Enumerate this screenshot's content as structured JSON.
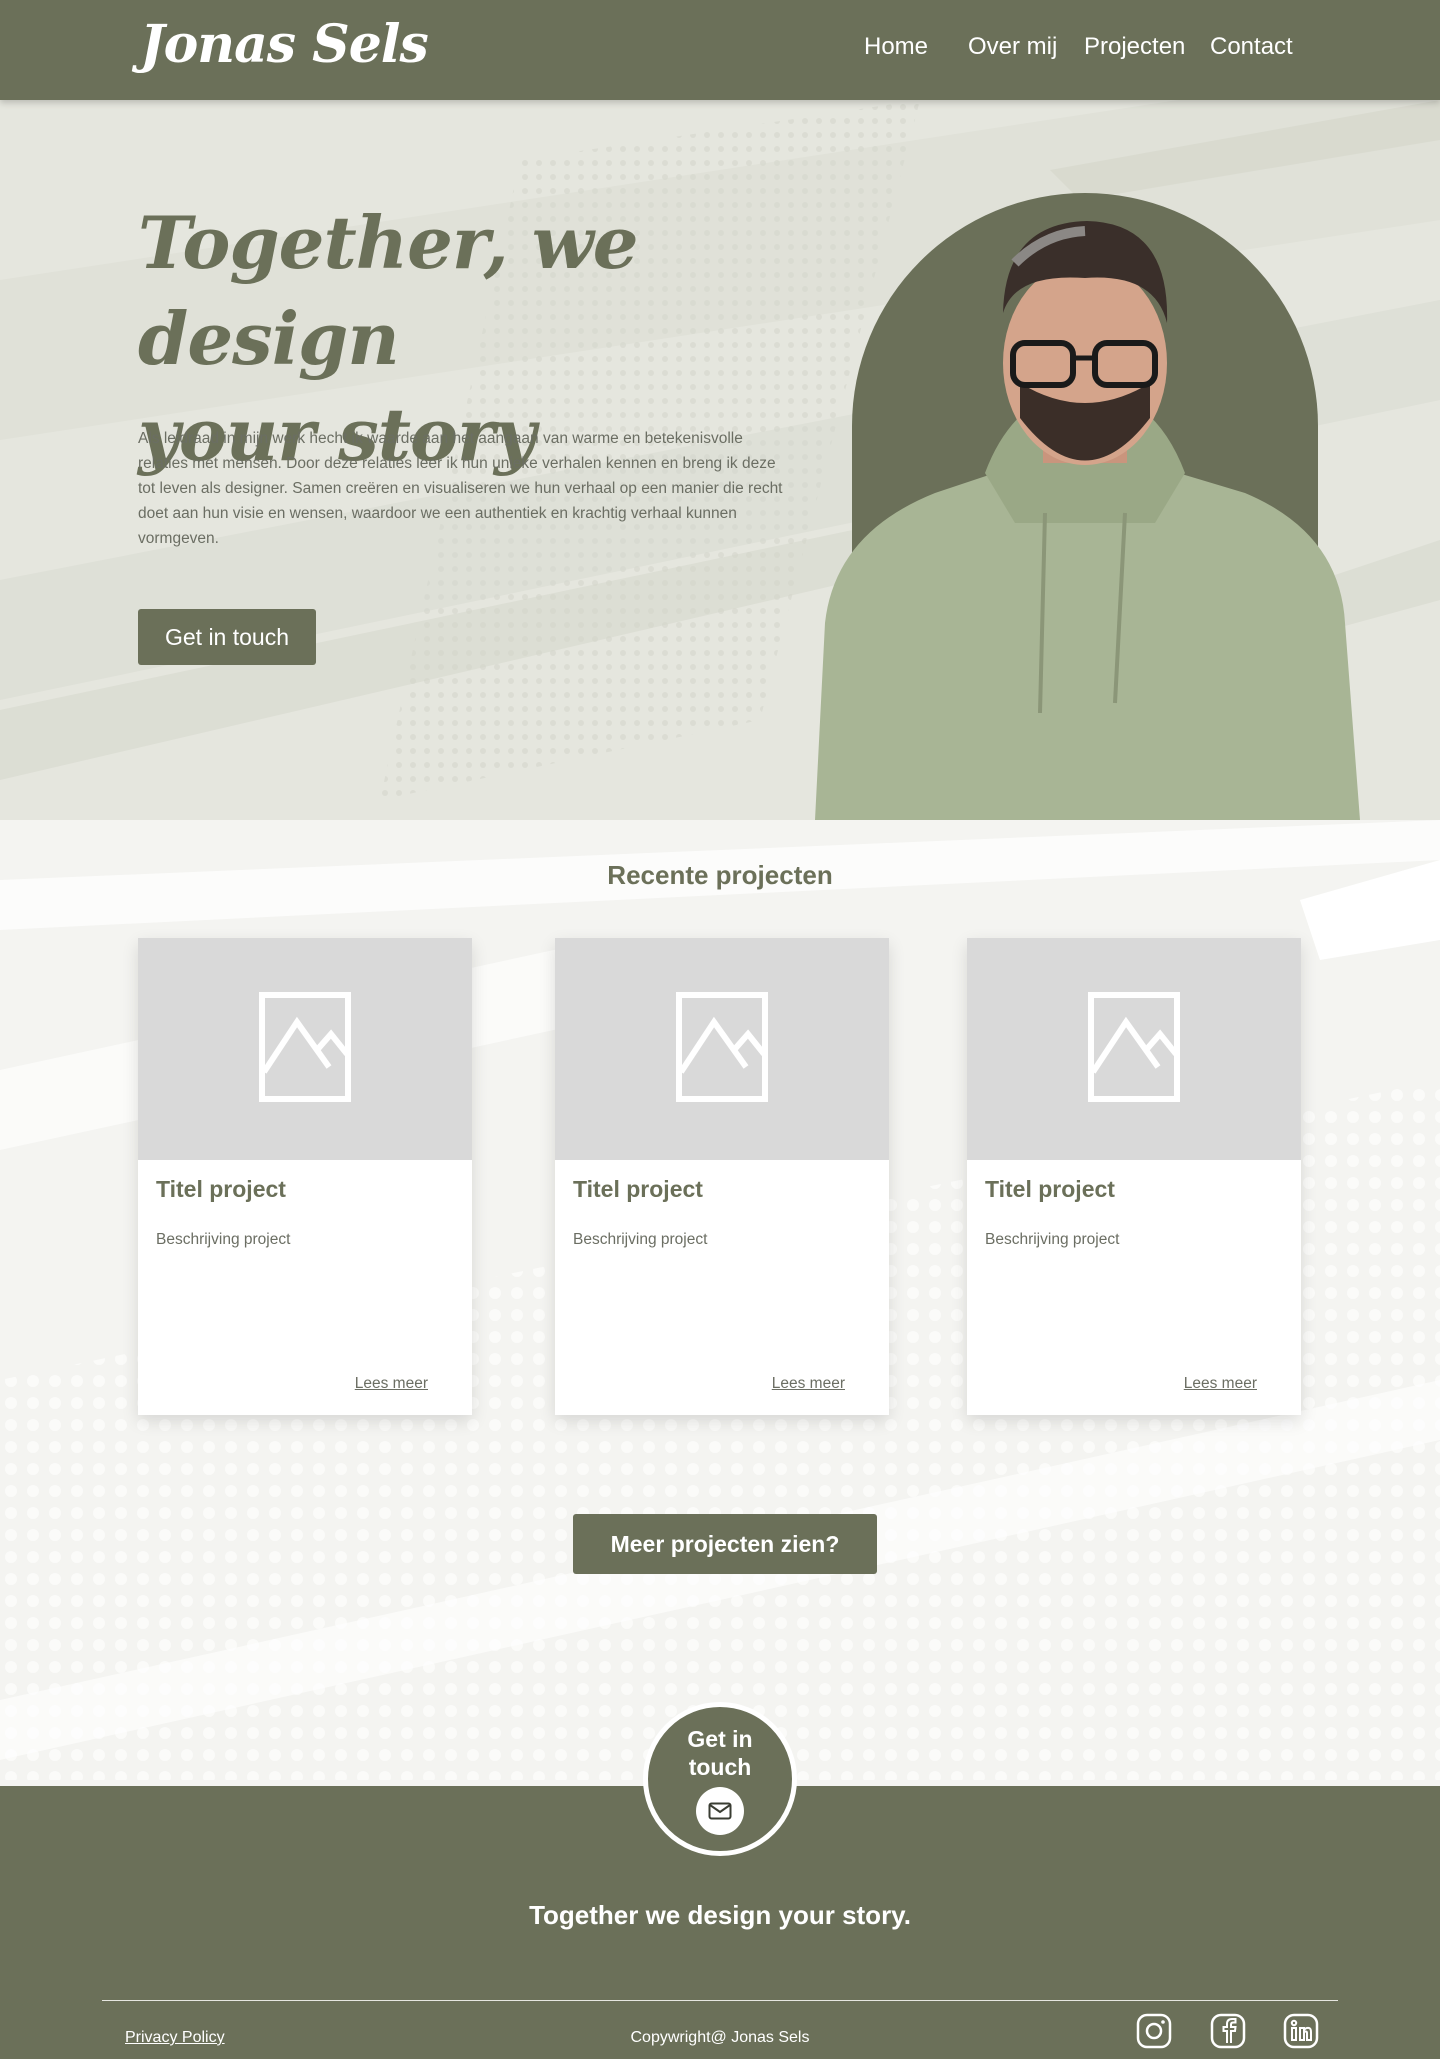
{
  "header": {
    "logo": "Jonas Sels",
    "nav": [
      "Home",
      "Over mij",
      "Projecten",
      "Contact"
    ]
  },
  "hero": {
    "title_line1": "Together, we design",
    "title_line2": "your story",
    "text": "Als leidraad in mijn werk hecht ik waarde aan het aangaan van warme en betekenisvolle relaties met mensen. Door deze relaties leer ik hun unieke verhalen kennen en breng ik deze tot leven als designer. Samen creëren en visualiseren we hun verhaal op een manier die recht doet aan hun visie en wensen, waardoor we een authentiek en krachtig verhaal kunnen vormgeven.",
    "button": "Get in touch"
  },
  "projects": {
    "title": "Recente projecten",
    "cards": [
      {
        "title": "Titel project",
        "description": "Beschrijving project",
        "link": "Lees meer"
      },
      {
        "title": "Titel project",
        "description": "Beschrijving project",
        "link": "Lees meer"
      },
      {
        "title": "Titel project",
        "description": "Beschrijving project",
        "link": "Lees meer"
      }
    ],
    "more_button": "Meer projecten zien?"
  },
  "contact": {
    "label_line1": "Get in",
    "label_line2": "touch",
    "icon": "mail-icon"
  },
  "footer": {
    "tagline": "Together we design your story.",
    "privacy": "Privacy Policy",
    "copyright": "Copywright@ Jonas Sels",
    "social_icons": [
      "instagram-icon",
      "facebook-icon",
      "linkedin-icon"
    ]
  },
  "colors": {
    "primary": "#6b7059",
    "hero_bg": "#e5e6de",
    "section_bg": "#f4f4f1",
    "placeholder": "#d9d9d9"
  }
}
